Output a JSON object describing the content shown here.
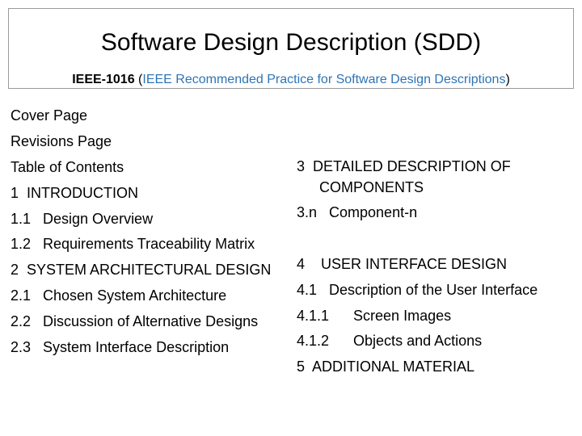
{
  "header": {
    "title": "Software Design Description (SDD)",
    "standard": "IEEE-1016",
    "paren_open": " (",
    "full_name": "IEEE Recommended Practice for Software Design Descriptions",
    "paren_close": ")"
  },
  "left_items": [
    "Cover Page",
    "Revisions Page",
    "Table of Contents",
    "1  INTRODUCTION",
    "1.1   Design Overview",
    "1.2   Requirements Traceability Matrix",
    "2  SYSTEM ARCHITECTURAL DESIGN",
    "2.1   Chosen System Architecture",
    "2.2   Discussion of Alternative Designs",
    "2.3   System Interface Description"
  ],
  "right_items": {
    "r0_line1": "3  DETAILED DESCRIPTION OF",
    "r0_line2": "COMPONENTS",
    "r1": "3.n   Component-n",
    "r2": "4    USER INTERFACE DESIGN",
    "r3": "4.1   Description of the User Interface",
    "r4": "4.1.1      Screen Images",
    "r5": "4.1.2      Objects and Actions",
    "r6": "5  ADDITIONAL MATERIAL"
  },
  "colors": {
    "accent": "#2e74b5",
    "border": "#9a9a9a"
  }
}
